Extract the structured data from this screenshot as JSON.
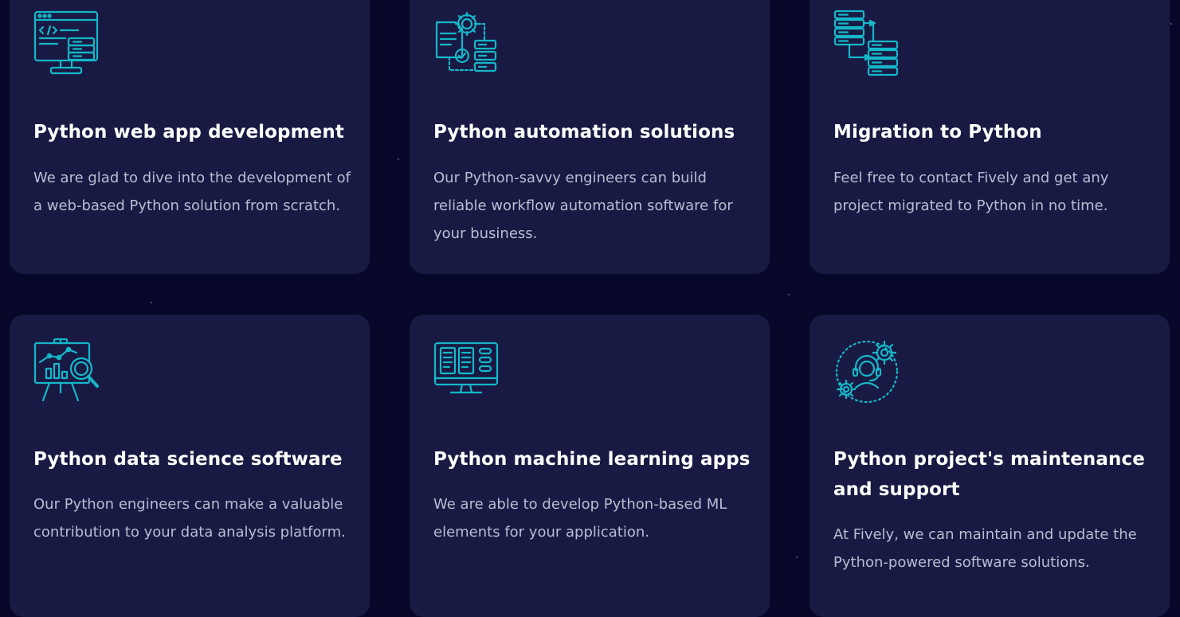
{
  "colors": {
    "background": "#07072a",
    "card": "#181a43",
    "accent": "#15b7c9",
    "title": "#ffffff",
    "text": "#b9bcd2"
  },
  "services": [
    {
      "icon": "web-code-server-icon",
      "title": "Python web app development",
      "description": "We are glad to dive into the development of a web-based Python solution from scratch."
    },
    {
      "icon": "automation-gear-document-icon",
      "title": "Python automation solutions",
      "description": "Our Python-savvy engineers can build reliable workflow automation software for your business."
    },
    {
      "icon": "migration-servers-icon",
      "title": "Migration to Python",
      "description": "Feel free to contact Fively and get any project migrated to Python in no time."
    },
    {
      "icon": "data-science-board-icon",
      "title": "Python data science software",
      "description": "Our Python engineers can make a valuable contribution to your data analysis platform."
    },
    {
      "icon": "machine-learning-monitor-icon",
      "title": "Python machine learning apps",
      "description": "We are able to develop Python-based ML elements for your application."
    },
    {
      "icon": "support-headset-gears-icon",
      "title": "Python project's maintenance and support",
      "description": "At Fively, we can maintain and update the Python-powered software solutions."
    }
  ]
}
